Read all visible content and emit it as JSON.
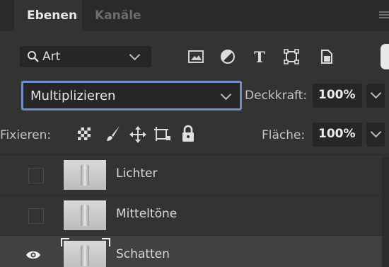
{
  "tabs": {
    "active": "Ebenen",
    "inactive": "Kanäle"
  },
  "filter": {
    "label": "Art",
    "icons": [
      "search-icon",
      "image-filter-icon",
      "adjustment-filter-icon",
      "type-filter-icon",
      "shape-filter-icon",
      "smart-object-filter-icon"
    ]
  },
  "blend": {
    "mode": "Multiplizieren",
    "opacity_label": "Deckkraft:",
    "opacity_value": "100%"
  },
  "lock": {
    "label": "Fixieren:",
    "icons": [
      "lock-transparent-pixels-icon",
      "lock-image-pixels-icon",
      "lock-position-icon",
      "lock-artboard-icon",
      "lock-all-icon"
    ],
    "fill_label": "Fläche:",
    "fill_value": "100%"
  },
  "layers": [
    {
      "name": "Lichter",
      "visible": false,
      "selected": false
    },
    {
      "name": "Mitteltöne",
      "visible": false,
      "selected": false
    },
    {
      "name": "Schatten",
      "visible": true,
      "selected": true
    }
  ],
  "colors": {
    "panel": "#333333",
    "tabbar": "#2a2a2a",
    "field": "#262626",
    "focus_border": "#6f8fc8",
    "selected_row": "#414141"
  }
}
